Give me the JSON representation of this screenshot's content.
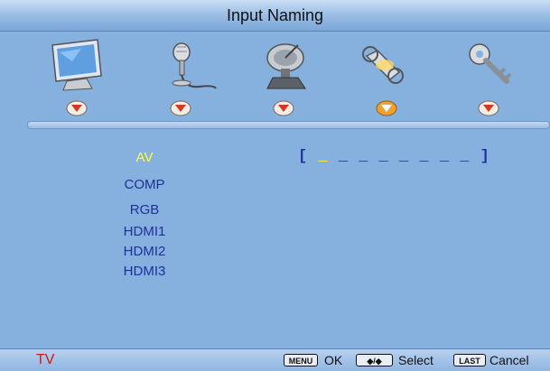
{
  "header": {
    "title": "Input Naming"
  },
  "icons": [
    {
      "name": "picture-icon"
    },
    {
      "name": "audio-icon"
    },
    {
      "name": "channel-icon"
    },
    {
      "name": "setup-icon"
    },
    {
      "name": "lock-icon"
    }
  ],
  "inputs": [
    "AV",
    "COMP",
    "RGB",
    "HDMI1",
    "HDMI2",
    "HDMI3"
  ],
  "selected_input": "AV",
  "name_field": {
    "open": "[",
    "cursor": "_",
    "blanks": "_ _ _ _ _ _ _",
    "close": "]"
  },
  "footer": {
    "source": "TV",
    "menu_key": "MENU",
    "ok_label": "OK",
    "select_key": "◆/◆",
    "select_label": "Select",
    "last_key": "LAST",
    "cancel_label": "Cancel"
  },
  "colors": {
    "background": "#86b0dd",
    "selected": "#ffff33",
    "item": "#1f2f9c",
    "source": "#d01818",
    "active_tab": "#f0a030"
  }
}
